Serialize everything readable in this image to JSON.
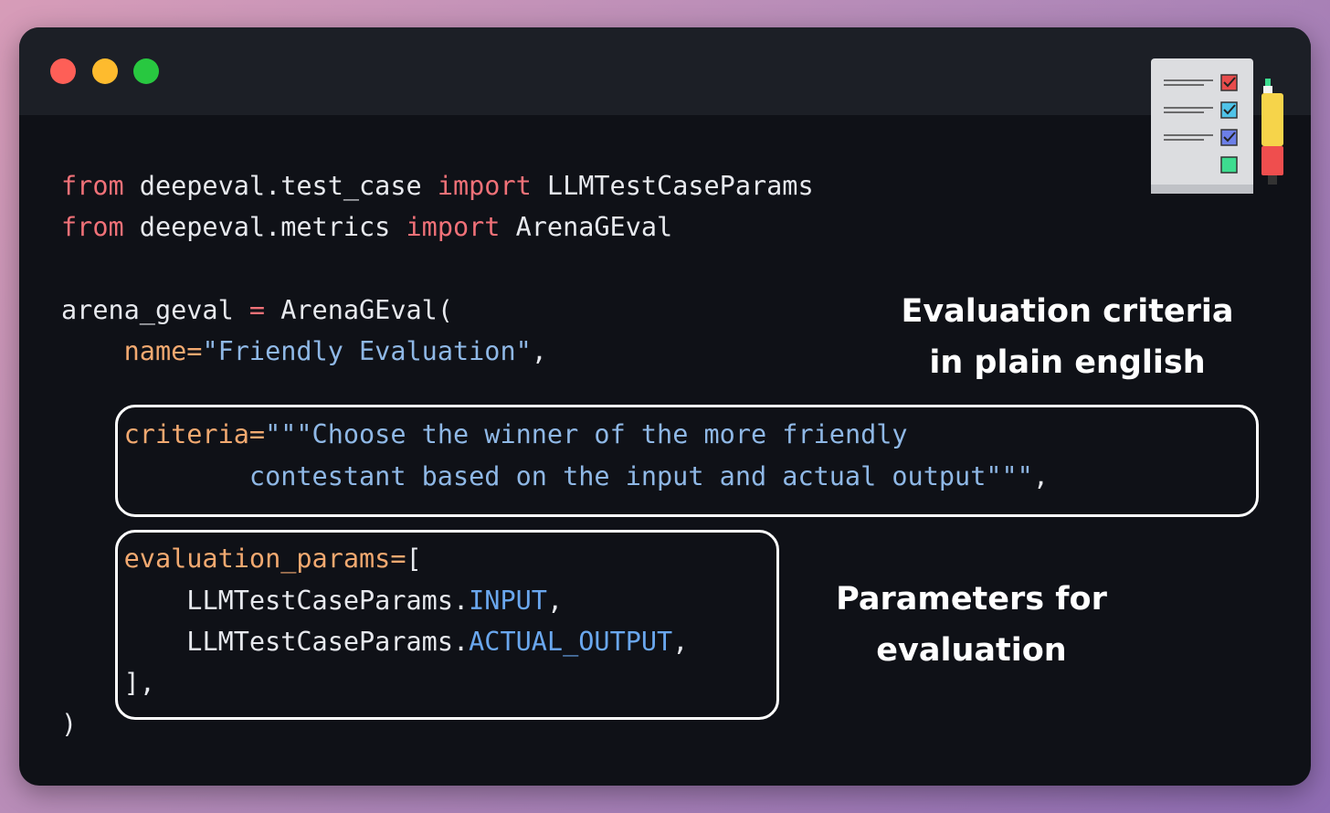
{
  "window": {
    "controls": [
      "close",
      "minimize",
      "maximize"
    ],
    "colors": {
      "close": "#fe5f57",
      "minimize": "#febb2e",
      "maximize": "#28c840",
      "background": "#0f1117",
      "titlebar": "#1c1f26"
    }
  },
  "code": {
    "line1": {
      "kw1": "from",
      "mod": " deepeval.test_case ",
      "kw2": "import",
      "name": " LLMTestCaseParams"
    },
    "line2": {
      "kw1": "from",
      "mod": " deepeval.metrics ",
      "kw2": "import",
      "name": " ArenaGEval"
    },
    "line3": {
      "var": "arena_geval ",
      "op": "=",
      "call": " ArenaGEval("
    },
    "line4": {
      "indent": "    ",
      "param": "name=",
      "value": "\"Friendly Evaluation\"",
      "tail": ","
    },
    "line5": {
      "indent": "    ",
      "param": "criteria=",
      "value": "\"\"\"Choose the winner of the more friendly"
    },
    "line6": {
      "indent": "            ",
      "value": "contestant based on the input and actual output\"\"\"",
      "tail": ","
    },
    "line7": {
      "indent": "    ",
      "param": "evaluation_params=",
      "tail": "["
    },
    "line8": {
      "indent": "        ",
      "obj": "LLMTestCaseParams.",
      "attr": "INPUT",
      "tail": ","
    },
    "line9": {
      "indent": "        ",
      "obj": "LLMTestCaseParams.",
      "attr": "ACTUAL_OUTPUT",
      "tail": ","
    },
    "line10": {
      "indent": "    ",
      "text": "],"
    },
    "line11": {
      "text": ")"
    }
  },
  "syntax_colors": {
    "keyword": "#f07178",
    "parameter": "#f2a970",
    "string": "#8fb8e6",
    "attribute": "#6aa7ee",
    "plain": "#e7e9ee"
  },
  "annotations": {
    "criteria": {
      "line1": "Evaluation criteria",
      "line2": "in plain english"
    },
    "params": {
      "line1": "Parameters for",
      "line2": "evaluation"
    }
  },
  "icons": {
    "decoration": "checklist-clipboard-icon",
    "pen": "marker-pen-icon"
  }
}
